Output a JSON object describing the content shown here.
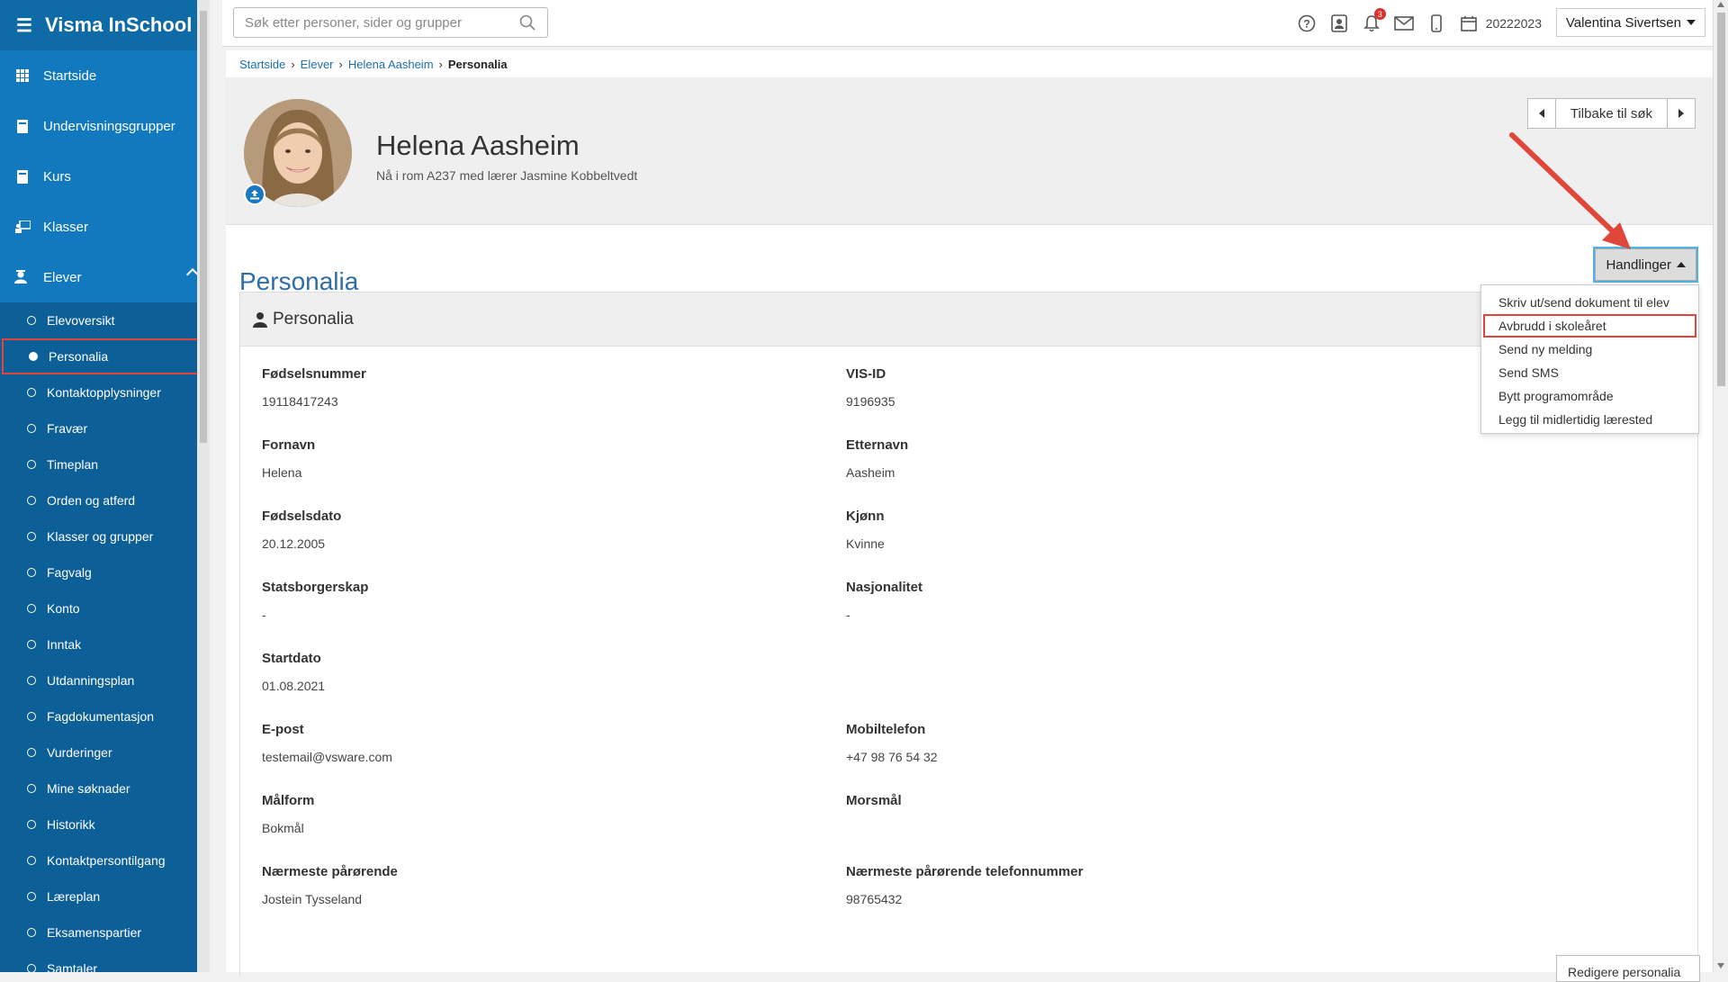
{
  "app": {
    "title": "Visma InSchool"
  },
  "sidebar": {
    "top_items": [
      {
        "label": "Startside",
        "icon": "grid-icon"
      },
      {
        "label": "Undervisningsgrupper",
        "icon": "book-icon"
      },
      {
        "label": "Kurs",
        "icon": "book-icon"
      },
      {
        "label": "Klasser",
        "icon": "presentation-icon"
      }
    ],
    "section": {
      "label": "Elever",
      "icon": "student-icon",
      "expanded": true
    },
    "sub_items": [
      "Elevoversikt",
      "Personalia",
      "Kontaktopplysninger",
      "Fravær",
      "Timeplan",
      "Orden og atferd",
      "Klasser og grupper",
      "Fagvalg",
      "Konto",
      "Inntak",
      "Utdanningsplan",
      "Fagdokumentasjon",
      "Vurderinger",
      "Mine søknader",
      "Historikk",
      "Kontaktpersontilgang",
      "Læreplan",
      "Eksamenspartier",
      "Samtaler"
    ],
    "active_sub_item": "Personalia"
  },
  "topbar": {
    "search_placeholder": "Søk etter personer, sider og grupper",
    "notification_count": "3",
    "school_year": "20222023",
    "user_name": "Valentina Sivertsen"
  },
  "breadcrumb": {
    "items": [
      "Startside",
      "Elever",
      "Helena Aasheim"
    ],
    "current": "Personalia"
  },
  "student": {
    "name": "Helena Aasheim",
    "location_text": "Nå i rom A237 med lærer Jasmine Kobbeltvedt"
  },
  "navigation": {
    "back_label": "Tilbake til søk"
  },
  "page": {
    "title": "Personalia",
    "actions_label": "Handlinger",
    "panel_title": "Personalia",
    "edit_button": "Redigere personalia"
  },
  "actions_menu": [
    "Skriv ut/send dokument til elev",
    "Avbrudd i skoleåret",
    "Send ny melding",
    "Send SMS",
    "Bytt programområde",
    "Legg til midlertidig lærested"
  ],
  "actions_menu_highlighted": "Avbrudd i skoleåret",
  "fields": [
    {
      "label": "Fødselsnummer",
      "value": "19118417243"
    },
    {
      "label": "VIS-ID",
      "value": "9196935"
    },
    {
      "label": "Fornavn",
      "value": "Helena"
    },
    {
      "label": "Etternavn",
      "value": "Aasheim"
    },
    {
      "label": "Fødselsdato",
      "value": "20.12.2005"
    },
    {
      "label": "Kjønn",
      "value": "Kvinne"
    },
    {
      "label": "Statsborgerskap",
      "value": "-"
    },
    {
      "label": "Nasjonalitet",
      "value": "-"
    },
    {
      "label": "Startdato",
      "value": "01.08.2021"
    },
    {
      "label": "E-post",
      "value": "testemail@vsware.com"
    },
    {
      "label": "Mobiltelefon",
      "value": "+47 98 76 54 32"
    },
    {
      "label": "Målform",
      "value": "Bokmål"
    },
    {
      "label": "Morsmål",
      "value": ""
    },
    {
      "label": "Nærmeste pårørende",
      "value": "Jostein Tysseland"
    },
    {
      "label": "Nærmeste pårørende telefonnummer",
      "value": "98765432"
    }
  ],
  "colors": {
    "sidebar": "#0f6aa8",
    "accent": "#2c6eaa",
    "highlight": "#e0463a",
    "badge": "#d9342b"
  }
}
